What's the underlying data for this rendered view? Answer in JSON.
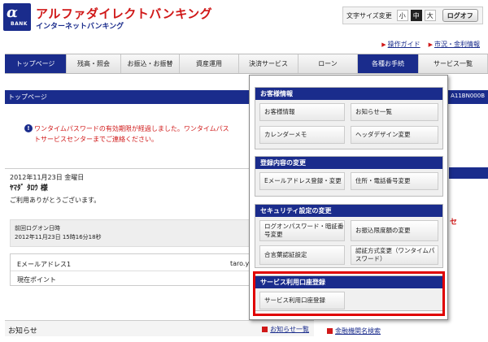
{
  "header": {
    "logo": {
      "mark": "α",
      "sub": "BANK",
      "icon": "alpha-bank-logo-icon"
    },
    "brand_name": "アルファダイレクトバンキング",
    "brand_sub": "インターネットバンキング",
    "font_size_label": "文字サイズ変更",
    "font_sizes": [
      "小",
      "中",
      "大"
    ],
    "font_size_selected": "中",
    "logoff_label": "ログオフ",
    "links": [
      {
        "label": "操作ガイド",
        "icon": "triangle-bullet-icon"
      },
      {
        "label": "市況・金利情報",
        "icon": "triangle-bullet-icon"
      }
    ]
  },
  "nav": {
    "tabs": [
      {
        "label": "トップページ"
      },
      {
        "label": "残高・照会"
      },
      {
        "label": "お振込・お振替"
      },
      {
        "label": "資産運用"
      },
      {
        "label": "決済サービス"
      },
      {
        "label": "ローン"
      },
      {
        "label": "各種お手続"
      },
      {
        "label": "サービス一覧"
      }
    ],
    "active": "トップページ",
    "open": "各種お手続"
  },
  "page": {
    "title": "トップページ",
    "code": "A11BN000B",
    "warning": "ワンタイムパスワードの有効期限が経過しました。ワンタイムパス",
    "warning_line2": "トサービスセンターまでご連絡ください。",
    "date": "2012年11月23日 金曜日",
    "user_name": "ﾔﾏﾀﾞ ﾀﾛｳ 様",
    "greeting": "ご利用ありがとうございます。",
    "last_logon_label": "前回ログオン日時",
    "last_logon_value": "2012年11月23日 15時16分18秒",
    "email_label": "Eメールアドレス1",
    "email_value": "taro.ya",
    "points_label": "現在ポイント",
    "news_title": "お知らせ",
    "news_more": "お知らせ一覧",
    "bank_search": "金融機関名検索",
    "right_mark": "セ"
  },
  "dropdown": {
    "sections": [
      {
        "title": "お客様情報",
        "items": [
          "お客様情報",
          "お知らせ一覧",
          "カレンダーメモ",
          "ヘッダデザイン変更"
        ]
      },
      {
        "title": "登録内容の変更",
        "items": [
          "Eメールアドレス登録・変更",
          "住所・電話番号変更"
        ]
      },
      {
        "title": "セキュリティ設定の変更",
        "items": [
          "ログオンパスワード・暗証番号変更",
          "お振込限度額の変更",
          "合言葉認証設定",
          "認証方式変更（ワンタイムパスワード）"
        ]
      },
      {
        "title": "サービス利用口座登録",
        "items": [
          "サービス利用口座登録"
        ]
      }
    ],
    "highlight_color": "#e00000"
  },
  "colors": {
    "brand_red": "#d01818",
    "navy": "#1a2c8c"
  }
}
